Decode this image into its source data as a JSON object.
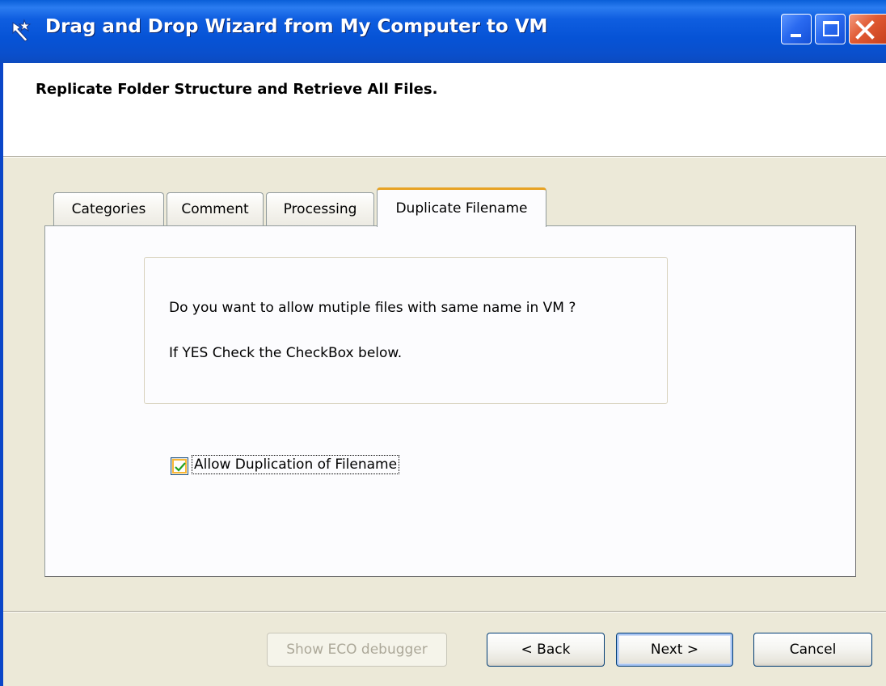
{
  "window": {
    "title": "Drag and Drop Wizard from My Computer to VM",
    "app_icon": "wizard-wand-icon",
    "controls": [
      "minimize-icon",
      "maximize-icon",
      "close-icon"
    ]
  },
  "header": {
    "title": "Replicate Folder Structure and Retrieve All Files."
  },
  "tabs": [
    {
      "label": "Categories",
      "active": false
    },
    {
      "label": "Comment",
      "active": false
    },
    {
      "label": "Processing",
      "active": false
    },
    {
      "label": "Duplicate Filename",
      "active": true
    }
  ],
  "panel": {
    "question": "Do you want to allow mutiple files with same name in VM ?",
    "instruction": "If YES Check the CheckBox below.",
    "checkbox": {
      "label": "Allow Duplication of Filename",
      "checked": true
    }
  },
  "footer": {
    "eco_debugger_label": "Show ECO debugger",
    "back_label": "< Back",
    "next_label": "Next >",
    "cancel_label": "Cancel"
  },
  "colors": {
    "titlebar": "#0653d6",
    "active_tab_accent": "#e7a324",
    "dialog_bg": "#ece9d8"
  }
}
